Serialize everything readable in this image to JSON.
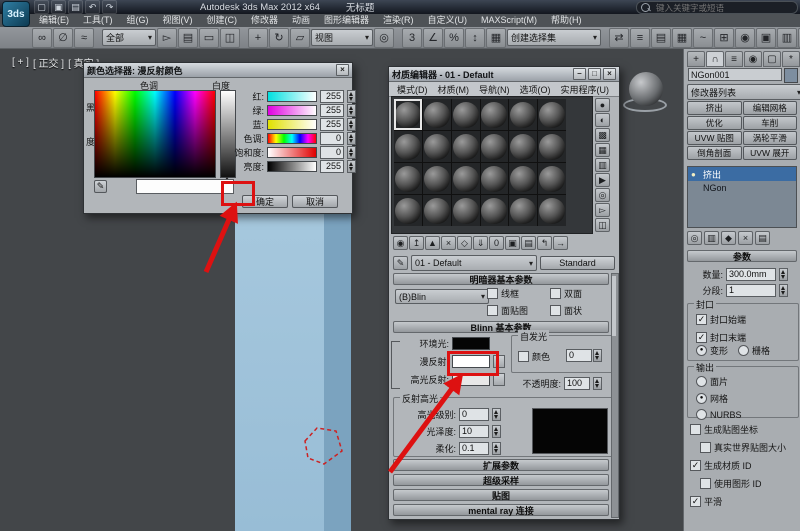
{
  "annotation_color": "#dd1111",
  "titlebar": {
    "app_button_label": "3ds",
    "app_title": "Autodesk 3ds Max 2012 x64",
    "doc_title": "无标题",
    "search_placeholder": "键入关键字或短语",
    "qat_icons": [
      {
        "name": "new-scene-icon",
        "glyph": "▢"
      },
      {
        "name": "open-file-icon",
        "glyph": "▣"
      },
      {
        "name": "save-file-icon",
        "glyph": "▤"
      },
      {
        "name": "undo-icon",
        "glyph": "↶"
      },
      {
        "name": "redo-icon",
        "glyph": "↷"
      }
    ]
  },
  "menubar": {
    "items": [
      "编辑(E)",
      "工具(T)",
      "组(G)",
      "视图(V)",
      "创建(C)",
      "修改器",
      "动画",
      "图形编辑器",
      "渲染(R)",
      "自定义(U)",
      "MAXScript(M)",
      "帮助(H)"
    ]
  },
  "toolbar": {
    "left_icons": [
      {
        "name": "select-and-link-icon",
        "glyph": "∞"
      },
      {
        "name": "unlink-selection-icon",
        "glyph": "∅"
      },
      {
        "name": "bind-to-space-warp-icon",
        "glyph": "≈"
      }
    ],
    "filter_dropdown": "全部",
    "select_icons": [
      {
        "name": "select-object-icon",
        "glyph": "▻"
      },
      {
        "name": "select-by-name-icon",
        "glyph": "▤"
      },
      {
        "name": "selection-region-icon",
        "glyph": "▭"
      },
      {
        "name": "window-crossing-icon",
        "glyph": "◫"
      }
    ],
    "transform_icons": [
      {
        "name": "select-and-move-icon",
        "glyph": "+"
      },
      {
        "name": "select-and-rotate-icon",
        "glyph": "↻"
      },
      {
        "name": "select-and-scale-icon",
        "glyph": "▱"
      }
    ],
    "coord_dropdown": "视图",
    "pivot_icon": {
      "name": "use-pivot-point-center-icon",
      "glyph": "◎"
    },
    "snap_icons": [
      {
        "name": "snap-toggle-3d-icon",
        "glyph": "3"
      },
      {
        "name": "angle-snap-icon",
        "glyph": "∠"
      },
      {
        "name": "percent-snap-icon",
        "glyph": "%"
      },
      {
        "name": "spinner-snap-icon",
        "glyph": "↕"
      }
    ],
    "sets_icon": {
      "name": "named-selection-sets-icon",
      "glyph": "▦"
    },
    "sets_dropdown": "创建选择集",
    "right_icons": [
      {
        "name": "mirror-icon",
        "glyph": "⇄"
      },
      {
        "name": "align-icon",
        "glyph": "≡"
      },
      {
        "name": "layer-manager-icon",
        "glyph": "▤"
      },
      {
        "name": "graphite-ribbon-icon",
        "glyph": "▦"
      },
      {
        "name": "curve-editor-icon",
        "glyph": "~"
      },
      {
        "name": "schematic-view-icon",
        "glyph": "⊞"
      },
      {
        "name": "material-editor-icon",
        "glyph": "◉"
      },
      {
        "name": "render-setup-icon",
        "glyph": "▣"
      },
      {
        "name": "rendered-frame-icon",
        "glyph": "▥"
      },
      {
        "name": "render-production-icon",
        "glyph": "●"
      }
    ]
  },
  "viewport": {
    "labels": [
      "[ + ]",
      "[ 正交 ]",
      "[ 真实 ]"
    ]
  },
  "color_selector": {
    "title": "颜色选择器: 漫反射颜色",
    "close_glyph": "×",
    "hue_label": "色调",
    "whiteness_label": "白度",
    "black_char": "黑",
    "degree_char": "度",
    "channels": [
      {
        "label": "红:",
        "value": "255",
        "style": "background:linear-gradient(90deg,#00e0e0,#ffffff)"
      },
      {
        "label": "绿:",
        "value": "255",
        "style": "background:linear-gradient(90deg,#e000e0,#ffffff)"
      },
      {
        "label": "蓝:",
        "value": "255",
        "style": "background:linear-gradient(90deg,#e0e000,#ffffff)"
      },
      {
        "label": "色调:",
        "value": "0",
        "style": "background:linear-gradient(90deg,#f00,#ff0,#0f0,#0ff,#00f,#f0f,#f00)"
      },
      {
        "label": "饱和度:",
        "value": "0",
        "style": "background:linear-gradient(90deg,#ffffff,#e00000)"
      },
      {
        "label": "亮度:",
        "value": "255",
        "style": "background:linear-gradient(90deg,#000000,#ffffff)"
      }
    ],
    "ok_label": "确定",
    "cancel_label": "取消"
  },
  "material_editor": {
    "title": "材质编辑器 - 01 - Default",
    "btn_min": "–",
    "btn_max": "□",
    "btn_close": "×",
    "menu": [
      "模式(D)",
      "材质(M)",
      "导航(N)",
      "选项(O)",
      "实用程序(U)"
    ],
    "slots": [
      "true",
      "false",
      "false",
      "false",
      "false",
      "false",
      "false",
      "false",
      "false",
      "false",
      "false",
      "false",
      "false",
      "false",
      "false",
      "false",
      "false",
      "false",
      "false",
      "false",
      "false",
      "false",
      "false",
      "false"
    ],
    "side_icons": [
      {
        "name": "sample-type-icon",
        "glyph": "●"
      },
      {
        "name": "backlight-icon",
        "glyph": "◐"
      },
      {
        "name": "background-icon",
        "glyph": "▩"
      },
      {
        "name": "sample-uv-tiling-icon",
        "glyph": "▦"
      },
      {
        "name": "video-color-check-icon",
        "glyph": "▥"
      },
      {
        "name": "make-preview-icon",
        "glyph": "▶"
      },
      {
        "name": "options-icon",
        "glyph": "◎"
      },
      {
        "name": "select-by-material-icon",
        "glyph": "▻"
      },
      {
        "name": "material-map-navigator-icon",
        "glyph": "◫"
      }
    ],
    "bottom_icons": [
      {
        "name": "get-material-icon",
        "glyph": "◉"
      },
      {
        "name": "put-material-to-scene-icon",
        "glyph": "↥"
      },
      {
        "name": "assign-material-to-selection-icon",
        "glyph": "▲"
      },
      {
        "name": "reset-map-icon",
        "glyph": "×"
      },
      {
        "name": "make-material-copy-icon",
        "glyph": "◇"
      },
      {
        "name": "put-to-library-icon",
        "glyph": "⇓"
      },
      {
        "name": "material-id-channel-icon",
        "glyph": "0"
      },
      {
        "name": "show-map-in-viewport-icon",
        "glyph": "▣"
      },
      {
        "name": "show-end-result-icon",
        "glyph": "▤"
      },
      {
        "name": "go-to-parent-icon",
        "glyph": "↰"
      },
      {
        "name": "go-forward-to-sibling-icon",
        "glyph": "→"
      }
    ],
    "picker_icon": "✎",
    "name_dropdown": "01 - Default",
    "type_button": "Standard",
    "shader_rollout_title": "明暗器基本参数",
    "shader_type": "(B)Blin",
    "shader_checks": [
      {
        "label": "线框",
        "mark": ""
      },
      {
        "label": "双面",
        "mark": ""
      },
      {
        "label": "面贴图",
        "mark": ""
      },
      {
        "label": "面状",
        "mark": ""
      }
    ],
    "blinn_rollout_title": "Blinn 基本参数",
    "ambient_label": "环境光:",
    "diffuse_label": "漫反射:",
    "specular_label": "高光反射:",
    "selfillum_title": "自发光",
    "selfillum_check": "颜色",
    "selfillum_value": "0",
    "opacity_label": "不透明度:",
    "opacity_value": "100",
    "highlights_title": "反射高光",
    "highlight_rows": [
      {
        "label": "高光级别:",
        "value": "0"
      },
      {
        "label": "光泽度:",
        "value": "10"
      },
      {
        "label": "柔化:",
        "value": "0.1"
      }
    ],
    "bottom_rollouts": [
      "扩展参数",
      "超级采样",
      "贴图",
      "mental ray 连接"
    ]
  },
  "command_panel": {
    "tabs": [
      {
        "name": "tab-create-icon",
        "glyph": "+",
        "active": "false"
      },
      {
        "name": "tab-modify-icon",
        "glyph": "∩",
        "active": "true"
      },
      {
        "name": "tab-hierarchy-icon",
        "glyph": "≡",
        "active": "false"
      },
      {
        "name": "tab-motion-icon",
        "glyph": "◉",
        "active": "false"
      },
      {
        "name": "tab-display-icon",
        "glyph": "▢",
        "active": "false"
      },
      {
        "name": "tab-utilities-icon",
        "glyph": "*",
        "active": "false"
      }
    ],
    "object_name": "NGon001",
    "modifier_list_label": "修改器列表",
    "modifier_buttons": [
      "挤出",
      "编辑网格",
      "优化",
      "车削",
      "UVW 贴图",
      "涡轮平滑",
      "倒角剖面",
      "UVW 展开"
    ],
    "stack_items": [
      {
        "label": "挤出",
        "icon": "●",
        "selected": "true"
      },
      {
        "label": "NGon",
        "icon": "",
        "selected": "false"
      }
    ],
    "stack_icons": [
      {
        "name": "pin-stack-icon",
        "glyph": "◎"
      },
      {
        "name": "show-end-result-icon",
        "glyph": "▥"
      },
      {
        "name": "make-unique-icon",
        "glyph": "◆"
      },
      {
        "name": "remove-modifier-icon",
        "glyph": "×"
      },
      {
        "name": "configure-modifier-sets-icon",
        "glyph": "▤"
      }
    ],
    "params_title": "参数",
    "amount_label": "数量:",
    "amount_value": "300.0mm",
    "segments_label": "分段:",
    "segments_value": "1",
    "cap_group_title": "封口",
    "cap_checks": [
      {
        "label": "封口始端",
        "mark": "✓"
      },
      {
        "label": "封口末端",
        "mark": "✓"
      }
    ],
    "cap_radios": [
      {
        "label": "变形",
        "dot": "●"
      },
      {
        "label": "栅格",
        "dot": ""
      }
    ],
    "output_group_title": "输出",
    "output_radios": [
      {
        "label": "面片",
        "dot": ""
      },
      {
        "label": "网格",
        "dot": "●"
      },
      {
        "label": "NURBS",
        "dot": ""
      }
    ],
    "bottom_checks": [
      {
        "label": "生成贴图坐标",
        "mark": "",
        "indent": "false"
      },
      {
        "label": "真实世界贴图大小",
        "mark": "",
        "indent": "true"
      },
      {
        "label": "生成材质 ID",
        "mark": "✓",
        "indent": "false"
      },
      {
        "label": "使用图形 ID",
        "mark": "",
        "indent": "true"
      },
      {
        "label": "平滑",
        "mark": "✓",
        "indent": "false"
      }
    ]
  }
}
